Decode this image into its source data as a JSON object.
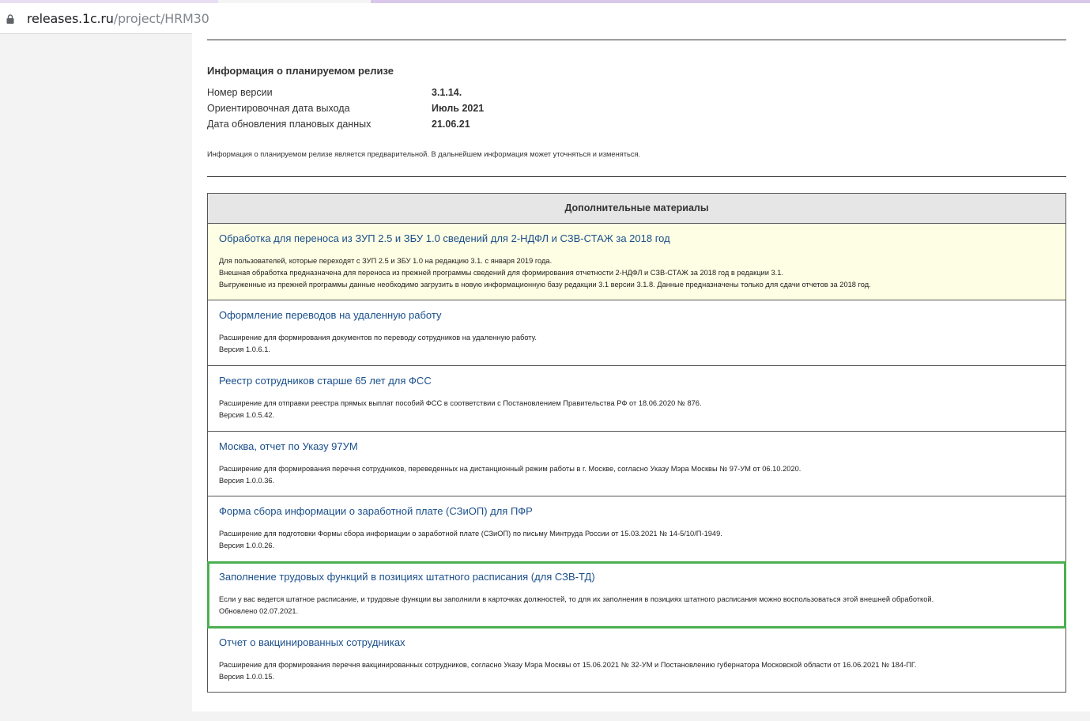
{
  "browser": {
    "url_host": "releases.1c.ru",
    "url_path": "/project/HRM30"
  },
  "planned_release": {
    "title": "Информация о планируемом релизе",
    "rows": [
      {
        "key": "Номер версии",
        "value": "3.1.14."
      },
      {
        "key": "Ориентировочная дата выхода",
        "value": "Июль 2021"
      },
      {
        "key": "Дата обновления плановых данных",
        "value": "21.06.21"
      }
    ],
    "note": "Информация о планируемом релизе является предварительной. В дальнейшем информация может уточняться и изменяться."
  },
  "materials": {
    "header": "Дополнительные материалы",
    "items": [
      {
        "title": "Обработка для переноса из ЗУП 2.5 и ЗБУ 1.0 сведений для 2-НДФЛ и СЗВ-СТАЖ за 2018 год",
        "lines": [
          "Для пользователей, которые переходят с ЗУП 2.5 и ЗБУ 1.0 на редакцию 3.1. с января 2019 года.",
          "Внешная обработка предназначена для переноса из прежней программы сведений для формирования отчетности 2-НДФЛ и СЗВ-СТАЖ за 2018 год в редакции 3.1.",
          "Выгруженные из прежней программы данные необходимо загрузить в новую информационную базу редакции 3.1 версии 3.1.8. Данные предназначены только для сдачи отчетов за 2018 год."
        ]
      },
      {
        "title": "Оформление переводов на удаленную работу",
        "lines": [
          "Расширение для формирования документов по переводу сотрудников на удаленную работу.",
          "Версия 1.0.6.1."
        ]
      },
      {
        "title": "Реестр сотрудников старше 65 лет для ФСС",
        "lines": [
          "Расширение для отправки реестра прямых выплат пособий ФСС в соответствии с Постановлением Правительства РФ от 18.06.2020 № 876.",
          "Версия 1.0.5.42."
        ]
      },
      {
        "title": "Москва, отчет по Указу 97УМ",
        "lines": [
          "Расширение для формирования перечня сотрудников, переведенных на дистанционный режим работы в г. Москве, согласно Указу Мэра Москвы № 97-УМ от 06.10.2020.",
          "Версия 1.0.0.36."
        ]
      },
      {
        "title": "Форма сбора информации о заработной плате (СЗиОП) для ПФР",
        "lines": [
          "Расширение для подготовки Формы сбора информации о заработной плате (СЗиОП) по письму Минтруда России от 15.03.2021 № 14-5/10/П-1949.",
          "Версия 1.0.0.26."
        ]
      },
      {
        "title": "Заполнение трудовых функций в позициях штатного расписания (для СЗВ-ТД)",
        "lines": [
          "Если у вас ведется штатное расписание, и трудовые функции вы заполнили в карточках должностей, то для их заполнения в позициях штатного расписания можно воспользоваться этой внешней обработкой.",
          "Обновлено 02.07.2021."
        ]
      },
      {
        "title": "Отчет о вакцинированных сотрудниках",
        "lines": [
          "Расширение для формирования перечня вакцинированных сотрудников, согласно Указу Мэра Москвы от 15.06.2021 № 32-УМ и Постановлению губернатора Московской области от 16.06.2021 № 184-ПГ.",
          "Версия 1.0.0.15."
        ]
      }
    ]
  }
}
